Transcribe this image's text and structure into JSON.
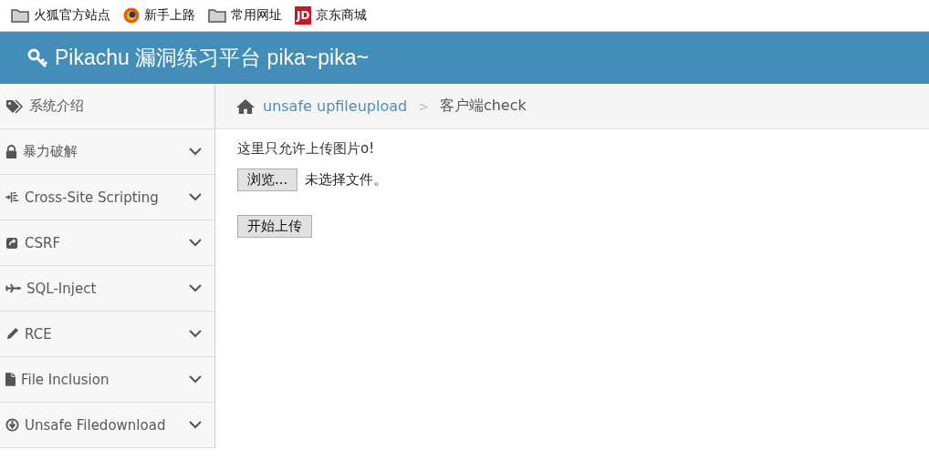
{
  "bookmarks": [
    {
      "kind": "folder",
      "label": "火狐官方站点"
    },
    {
      "kind": "browser",
      "label": "新手上路"
    },
    {
      "kind": "folder",
      "label": "常用网址"
    },
    {
      "kind": "logo",
      "logo_text": "JD",
      "label": "京东商城"
    }
  ],
  "header": {
    "title": "Pikachu 漏洞练习平台 pika~pika~"
  },
  "sidebar": {
    "items": [
      {
        "kind": "link",
        "label": "系统介绍"
      },
      {
        "kind": "submenu",
        "label": "暴力破解"
      },
      {
        "kind": "submenu",
        "label": "Cross-Site Scripting"
      },
      {
        "kind": "submenu",
        "label": "CSRF"
      },
      {
        "kind": "submenu",
        "label": "SQL-Inject"
      },
      {
        "kind": "submenu",
        "label": "RCE"
      },
      {
        "kind": "submenu",
        "label": "File Inclusion"
      },
      {
        "kind": "submenu",
        "label": "Unsafe Filedownload"
      }
    ]
  },
  "breadcrumb": {
    "parent": "unsafe upfileupload",
    "separator": ">",
    "current": "客户端check"
  },
  "content": {
    "notice": "这里只允许上传图片o!",
    "browse_button": "浏览...",
    "file_status": "未选择文件。",
    "upload_button": "开始上传"
  }
}
